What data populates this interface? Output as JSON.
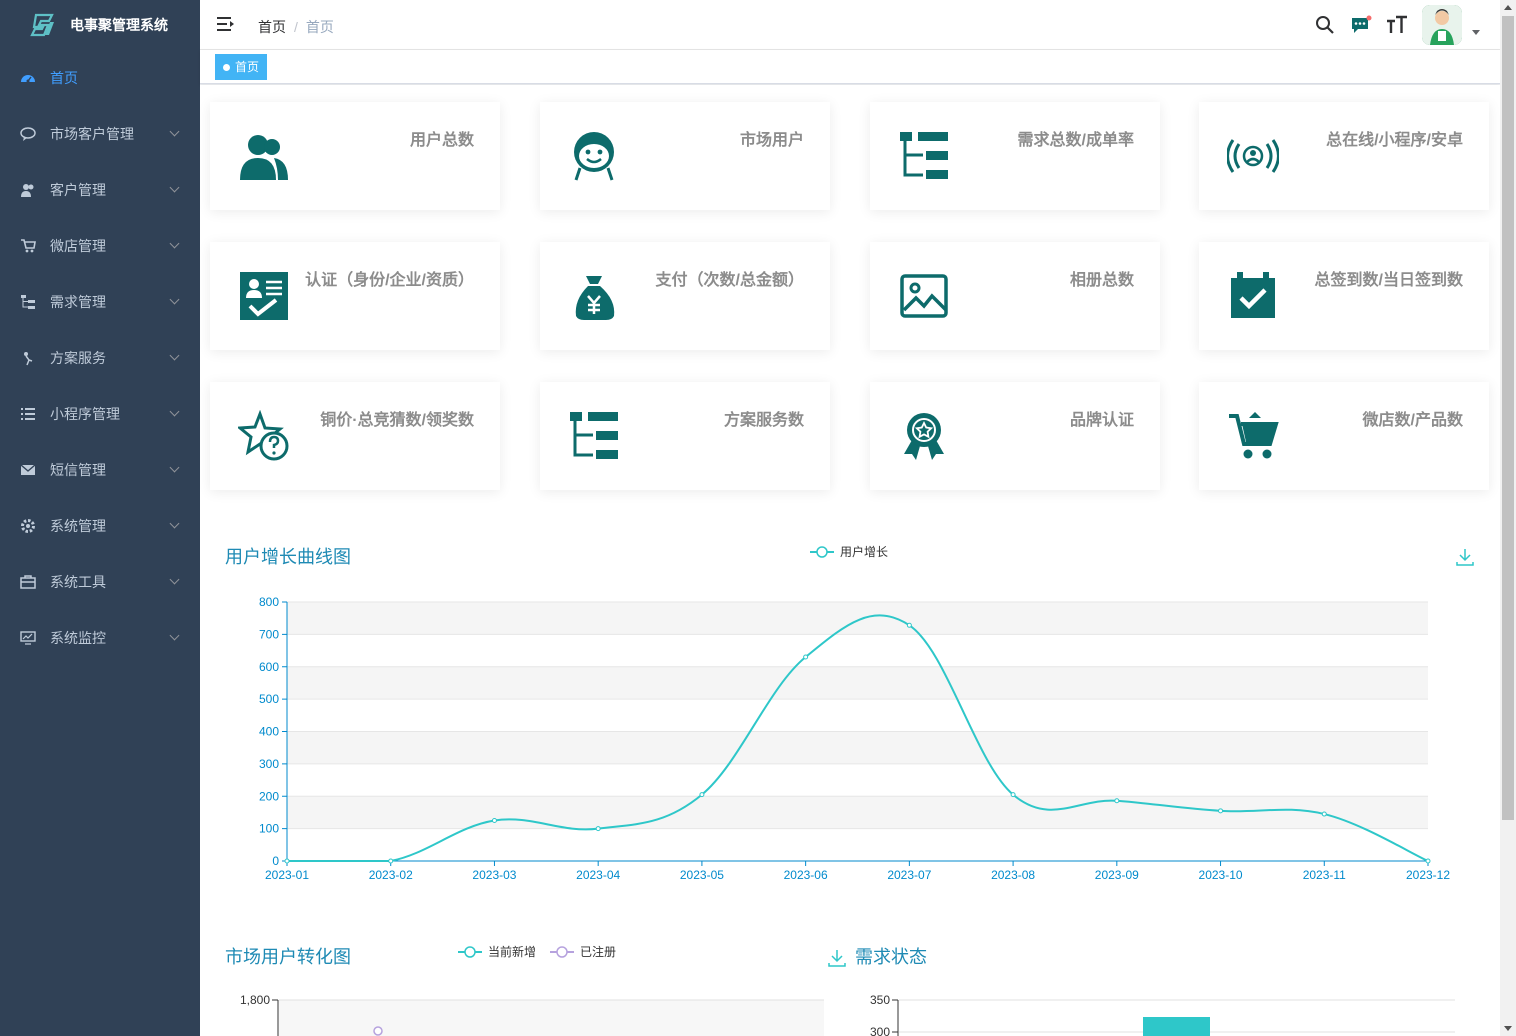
{
  "app": {
    "title": "电事聚管理系统"
  },
  "sidebar": {
    "items": [
      {
        "label": "首页",
        "icon": "dashboard-icon",
        "active": true
      },
      {
        "label": "市场客户管理",
        "icon": "chat-icon"
      },
      {
        "label": "客户管理",
        "icon": "people-icon"
      },
      {
        "label": "微店管理",
        "icon": "cart-icon"
      },
      {
        "label": "需求管理",
        "icon": "tree-icon"
      },
      {
        "label": "方案服务",
        "icon": "nested-icon"
      },
      {
        "label": "小程序管理",
        "icon": "list-icon"
      },
      {
        "label": "短信管理",
        "icon": "message-icon"
      },
      {
        "label": "系统管理",
        "icon": "system-icon"
      },
      {
        "label": "系统工具",
        "icon": "tool-icon"
      },
      {
        "label": "系统监控",
        "icon": "monitor-icon"
      }
    ]
  },
  "navbar": {
    "breadcrumb": [
      "首页",
      "首页"
    ]
  },
  "tags": [
    {
      "label": "首页"
    }
  ],
  "cards": [
    {
      "title": "用户总数",
      "icon": "users-icon"
    },
    {
      "title": "市场用户",
      "icon": "face-icon"
    },
    {
      "title": "需求总数/成单率",
      "icon": "tree-table-icon"
    },
    {
      "title": "总在线/小程序/安卓",
      "icon": "online-icon"
    },
    {
      "title": "认证（身份/企业/资质）",
      "icon": "certificate-icon"
    },
    {
      "title": "支付（次数/总金额）",
      "icon": "money-bag-icon"
    },
    {
      "title": "相册总数",
      "icon": "image-icon"
    },
    {
      "title": "总签到数/当日签到数",
      "icon": "calendar-check-icon"
    },
    {
      "title": "铜价·总竞猜数/领奖数",
      "icon": "star-question-icon"
    },
    {
      "title": "方案服务数",
      "icon": "tree-table-icon"
    },
    {
      "title": "品牌认证",
      "icon": "award-icon"
    },
    {
      "title": "微店数/产品数",
      "icon": "shopping-cart-icon"
    }
  ],
  "growth_chart": {
    "title": "用户增长曲线图",
    "legend": "用户增长"
  },
  "conversion_chart": {
    "title": "市场用户转化图",
    "legend": [
      "当前新增",
      "已注册"
    ],
    "y_top_tick": "1,800"
  },
  "demand_chart": {
    "title": "需求状态",
    "y_top_tick": "350",
    "y_second_tick": "300"
  },
  "chart_data": [
    {
      "type": "line",
      "title": "用户增长曲线图",
      "x": [
        "2023-01",
        "2023-02",
        "2023-03",
        "2023-04",
        "2023-05",
        "2023-06",
        "2023-07",
        "2023-08",
        "2023-09",
        "2023-10",
        "2023-11",
        "2023-12"
      ],
      "series": [
        {
          "name": "用户增长",
          "values": [
            0,
            0,
            125,
            100,
            205,
            630,
            728,
            205,
            186,
            155,
            145,
            0
          ]
        }
      ],
      "ylim": [
        0,
        800
      ],
      "yticks": [
        0,
        100,
        200,
        300,
        400,
        500,
        600,
        700,
        800
      ],
      "smooth": true,
      "color": "#2ec7c9",
      "legend_position": "top-center"
    }
  ],
  "colors": {
    "accent": "#2ec7c9",
    "sidebar": "#304156",
    "icon": "#0d6b6b",
    "title": "#1e8ab4"
  }
}
